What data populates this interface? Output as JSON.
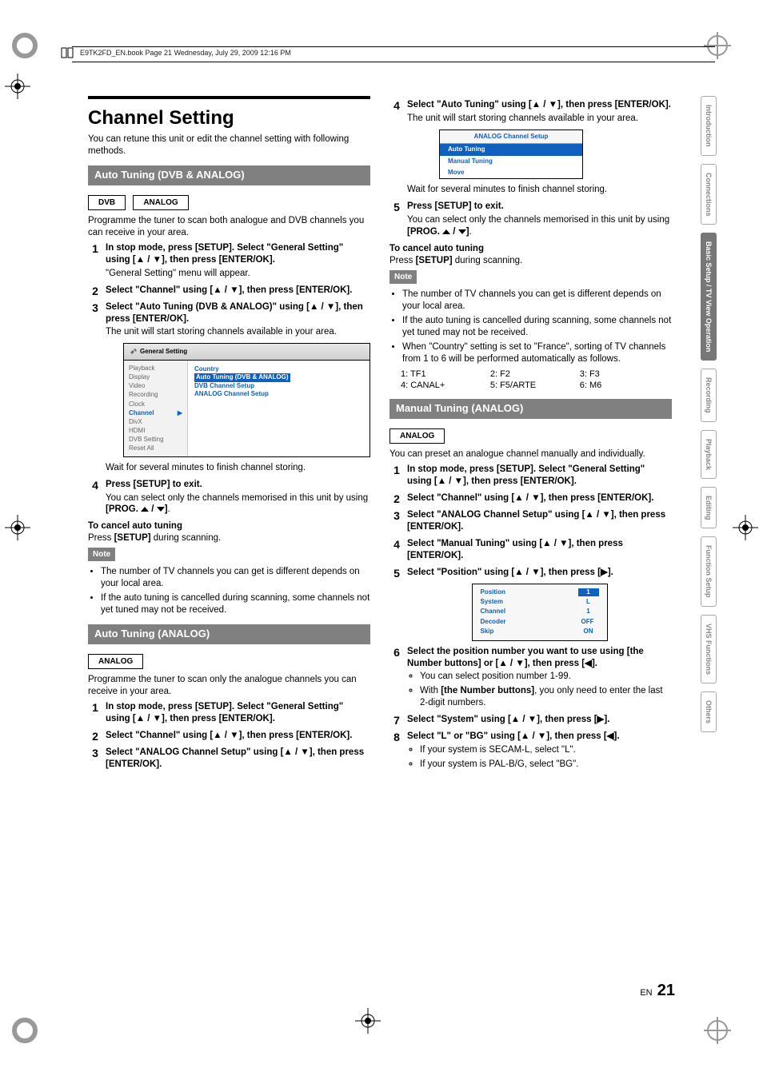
{
  "header_line": "E9TK2FD_EN.book  Page 21  Wednesday, July 29, 2009  12:16 PM",
  "page_heading": "Channel Setting",
  "page_intro": "You can retune this unit or edit the channel setting with following methods.",
  "section_a": {
    "title": "Auto Tuning (DVB & ANALOG)",
    "tags": [
      "DVB",
      "ANALOG"
    ],
    "intro": "Programme the tuner to scan both analogue and DVB channels you can receive in your area.",
    "steps": [
      {
        "bold": "In stop mode, press [SETUP]. Select \"General Setting\" using [▲ / ▼], then press [ENTER/OK].",
        "body": "\"General Setting\" menu will appear."
      },
      {
        "bold": "Select \"Channel\" using [▲ / ▼], then press [ENTER/OK]."
      },
      {
        "bold": "Select \"Auto Tuning (DVB & ANALOG)\" using [▲ / ▼], then press [ENTER/OK].",
        "body": "The unit will start storing channels available in your area."
      }
    ],
    "osd": {
      "title": "General Setting",
      "side_items": [
        "Playback",
        "Display",
        "Video",
        "Recording",
        "Clock",
        "Channel",
        "DivX",
        "HDMI",
        "DVB Setting",
        "Reset All"
      ],
      "side_selected": "Channel",
      "main_items": [
        "Country",
        "Auto Tuning (DVB & ANALOG)",
        "DVB Channel Setup",
        "ANALOG Channel Setup"
      ],
      "main_selected": "Auto Tuning (DVB & ANALOG)"
    },
    "after_osd": "Wait for several minutes to finish channel storing.",
    "step4": {
      "bold": "Press [SETUP] to exit.",
      "body": "You can select only the channels memorised in this unit by using [PROG. ⋀ / ⋁]."
    },
    "cancel_heading": "To cancel auto tuning",
    "cancel_body_pre": "Press ",
    "cancel_body_bold": "[SETUP]",
    "cancel_body_post": " during scanning.",
    "note_label": "Note",
    "notes": [
      "The number of TV channels you can get is different depends on your local area.",
      "If the auto tuning is cancelled during scanning, some channels not yet tuned may not be received."
    ]
  },
  "section_b": {
    "title": "Auto Tuning (ANALOG)",
    "tags": [
      "ANALOG"
    ],
    "intro": "Programme the tuner to scan only the analogue channels you can receive in your area.",
    "steps": [
      {
        "bold": "In stop mode, press [SETUP]. Select \"General Setting\" using [▲ / ▼], then press [ENTER/OK]."
      },
      {
        "bold": "Select \"Channel\" using [▲ / ▼], then press [ENTER/OK]."
      },
      {
        "bold": "Select \"ANALOG Channel Setup\" using [▲ / ▼], then press [ENTER/OK]."
      }
    ]
  },
  "section_b_right": {
    "step4": {
      "bold": "Select \"Auto Tuning\" using [▲ / ▼], then press [ENTER/OK].",
      "body": "The unit will start storing channels available in your area."
    },
    "osd_simple": {
      "title": "ANALOG Channel Setup",
      "rows": [
        "Auto Tuning",
        "Manual Tuning",
        "Move"
      ],
      "selected": "Auto Tuning"
    },
    "after_osd": "Wait for several minutes to finish channel storing.",
    "step5": {
      "bold": "Press [SETUP] to exit.",
      "body": "You can select only the channels memorised in this unit by using [PROG. ⋀ / ⋁]."
    },
    "cancel_heading": "To cancel auto tuning",
    "cancel_body_pre": "Press ",
    "cancel_body_bold": "[SETUP]",
    "cancel_body_post": " during scanning.",
    "note_label": "Note",
    "notes": [
      "The number of TV channels you can get is different depends on your local area.",
      "If the auto tuning is cancelled during scanning, some channels not yet tuned may not be received.",
      "When \"Country\" setting is set to \"France\", sorting of TV channels from 1 to 6 will be performed automatically as follows."
    ],
    "french_channels": [
      [
        "1: TF1",
        "2: F2",
        "3: F3"
      ],
      [
        "4: CANAL+",
        "5: F5/ARTE",
        "6: M6"
      ]
    ]
  },
  "section_c": {
    "title": "Manual Tuning (ANALOG)",
    "tags": [
      "ANALOG"
    ],
    "intro": "You can preset an analogue channel manually and individually.",
    "steps": [
      {
        "bold": "In stop mode, press [SETUP]. Select \"General Setting\" using [▲ / ▼], then press [ENTER/OK]."
      },
      {
        "bold": "Select \"Channel\" using [▲ / ▼], then press [ENTER/OK]."
      },
      {
        "bold": "Select \"ANALOG Channel Setup\" using [▲ / ▼], then press [ENTER/OK]."
      },
      {
        "bold": "Select \"Manual Tuning\" using [▲ / ▼], then press [ENTER/OK]."
      },
      {
        "bold": "Select \"Position\" using [▲ / ▼], then press [▶]."
      }
    ],
    "table": [
      {
        "k": "Position",
        "v": "1",
        "sel": true
      },
      {
        "k": "System",
        "v": "L"
      },
      {
        "k": "Channel",
        "v": "1"
      },
      {
        "k": "Decoder",
        "v": "OFF"
      },
      {
        "k": "Skip",
        "v": "ON"
      }
    ],
    "step6": {
      "bold": "Select the position number you want to use using [the Number buttons] or [▲ / ▼], then press [◀].",
      "subs": [
        "You can select position number 1-99.",
        {
          "pre": "With ",
          "b": "[the Number buttons]",
          "post": ", you only need to enter the last 2-digit numbers."
        }
      ]
    },
    "step7": {
      "bold": "Select \"System\" using [▲ / ▼], then press [▶]."
    },
    "step8": {
      "bold": "Select \"L\" or \"BG\" using [▲ / ▼], then press [◀].",
      "subs": [
        "If your system is SECAM-L, select \"L\".",
        "If your system is PAL-B/G, select \"BG\"."
      ]
    }
  },
  "tabs": [
    "Introduction",
    "Connections",
    "Basic Setup / TV View Operation",
    "Recording",
    "Playback",
    "Editing",
    "Function Setup",
    "VHS Functions",
    "Others"
  ],
  "active_tab": "Basic Setup / TV View Operation",
  "footer": {
    "lang": "EN",
    "page": "21"
  }
}
